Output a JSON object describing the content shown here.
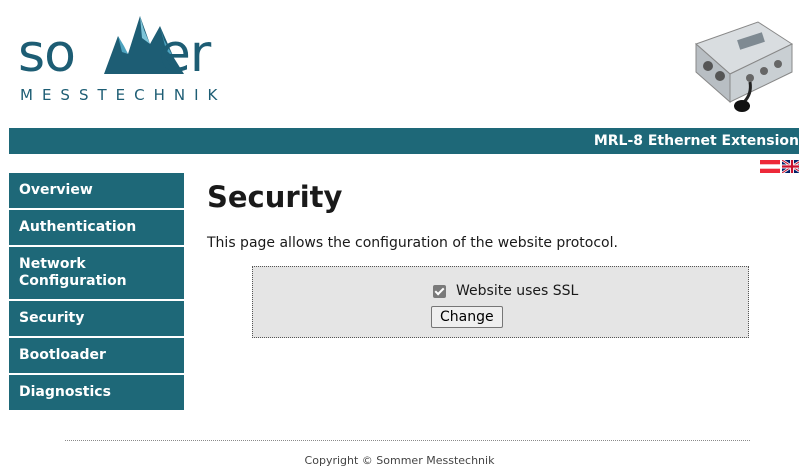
{
  "header": {
    "logo_word": "so  er",
    "logo_sub": "MESSTECHNIK",
    "banner_title": "MRL-8 Ethernet Extension"
  },
  "languages": [
    "de-flag-icon",
    "en-flag-icon"
  ],
  "sidebar": {
    "items": [
      {
        "label": "Overview"
      },
      {
        "label": "Authentication"
      },
      {
        "label": "Network Configuration"
      },
      {
        "label": "Security"
      },
      {
        "label": "Bootloader"
      },
      {
        "label": "Diagnostics"
      }
    ]
  },
  "main": {
    "title": "Security",
    "intro": "This page allows the configuration of the website protocol.",
    "ssl_label": "Website uses SSL",
    "ssl_checked": true,
    "change_label": "Change"
  },
  "footer": {
    "copyright": "Copyright © Sommer Messtechnik"
  },
  "colors": {
    "brand": "#1e6878",
    "form_bg": "#e5e5e5"
  }
}
